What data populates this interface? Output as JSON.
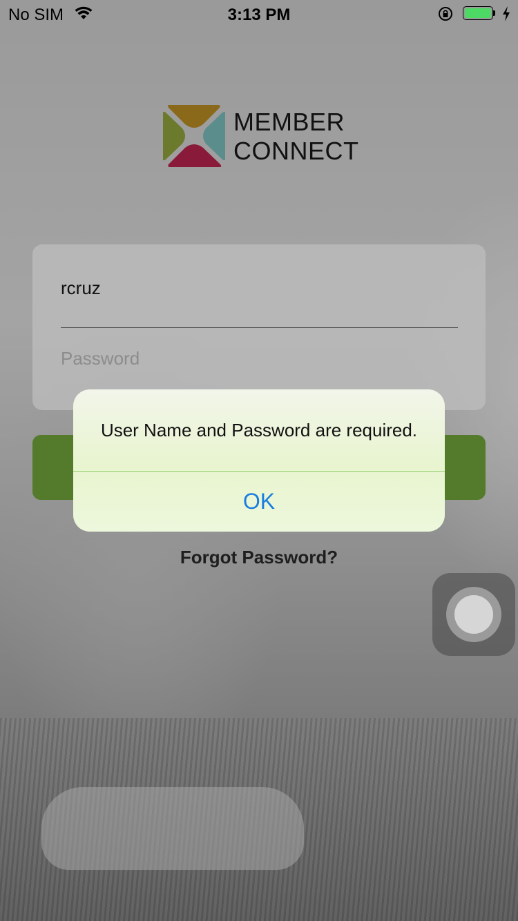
{
  "status_bar": {
    "carrier": "No SIM",
    "time": "3:13 PM",
    "battery_level": 1.0,
    "battery_color": "#4cd964",
    "icons": [
      "wifi-icon",
      "orientation-lock-icon",
      "battery-icon",
      "charging-bolt-icon"
    ]
  },
  "brand": {
    "line1": "MEMBER",
    "line2": "CONNECT",
    "logo_colors": [
      "#8a6a1a",
      "#6b7a2c",
      "#5a8d8c",
      "#8a1a3a"
    ]
  },
  "login": {
    "username_value": "rcruz",
    "password_placeholder": "Password",
    "button_color": "#547a2c",
    "forgot_label": "Forgot Password?"
  },
  "alert": {
    "message": "User Name and Password are required.",
    "ok_label": "OK",
    "ok_color": "#1a7ee0"
  }
}
